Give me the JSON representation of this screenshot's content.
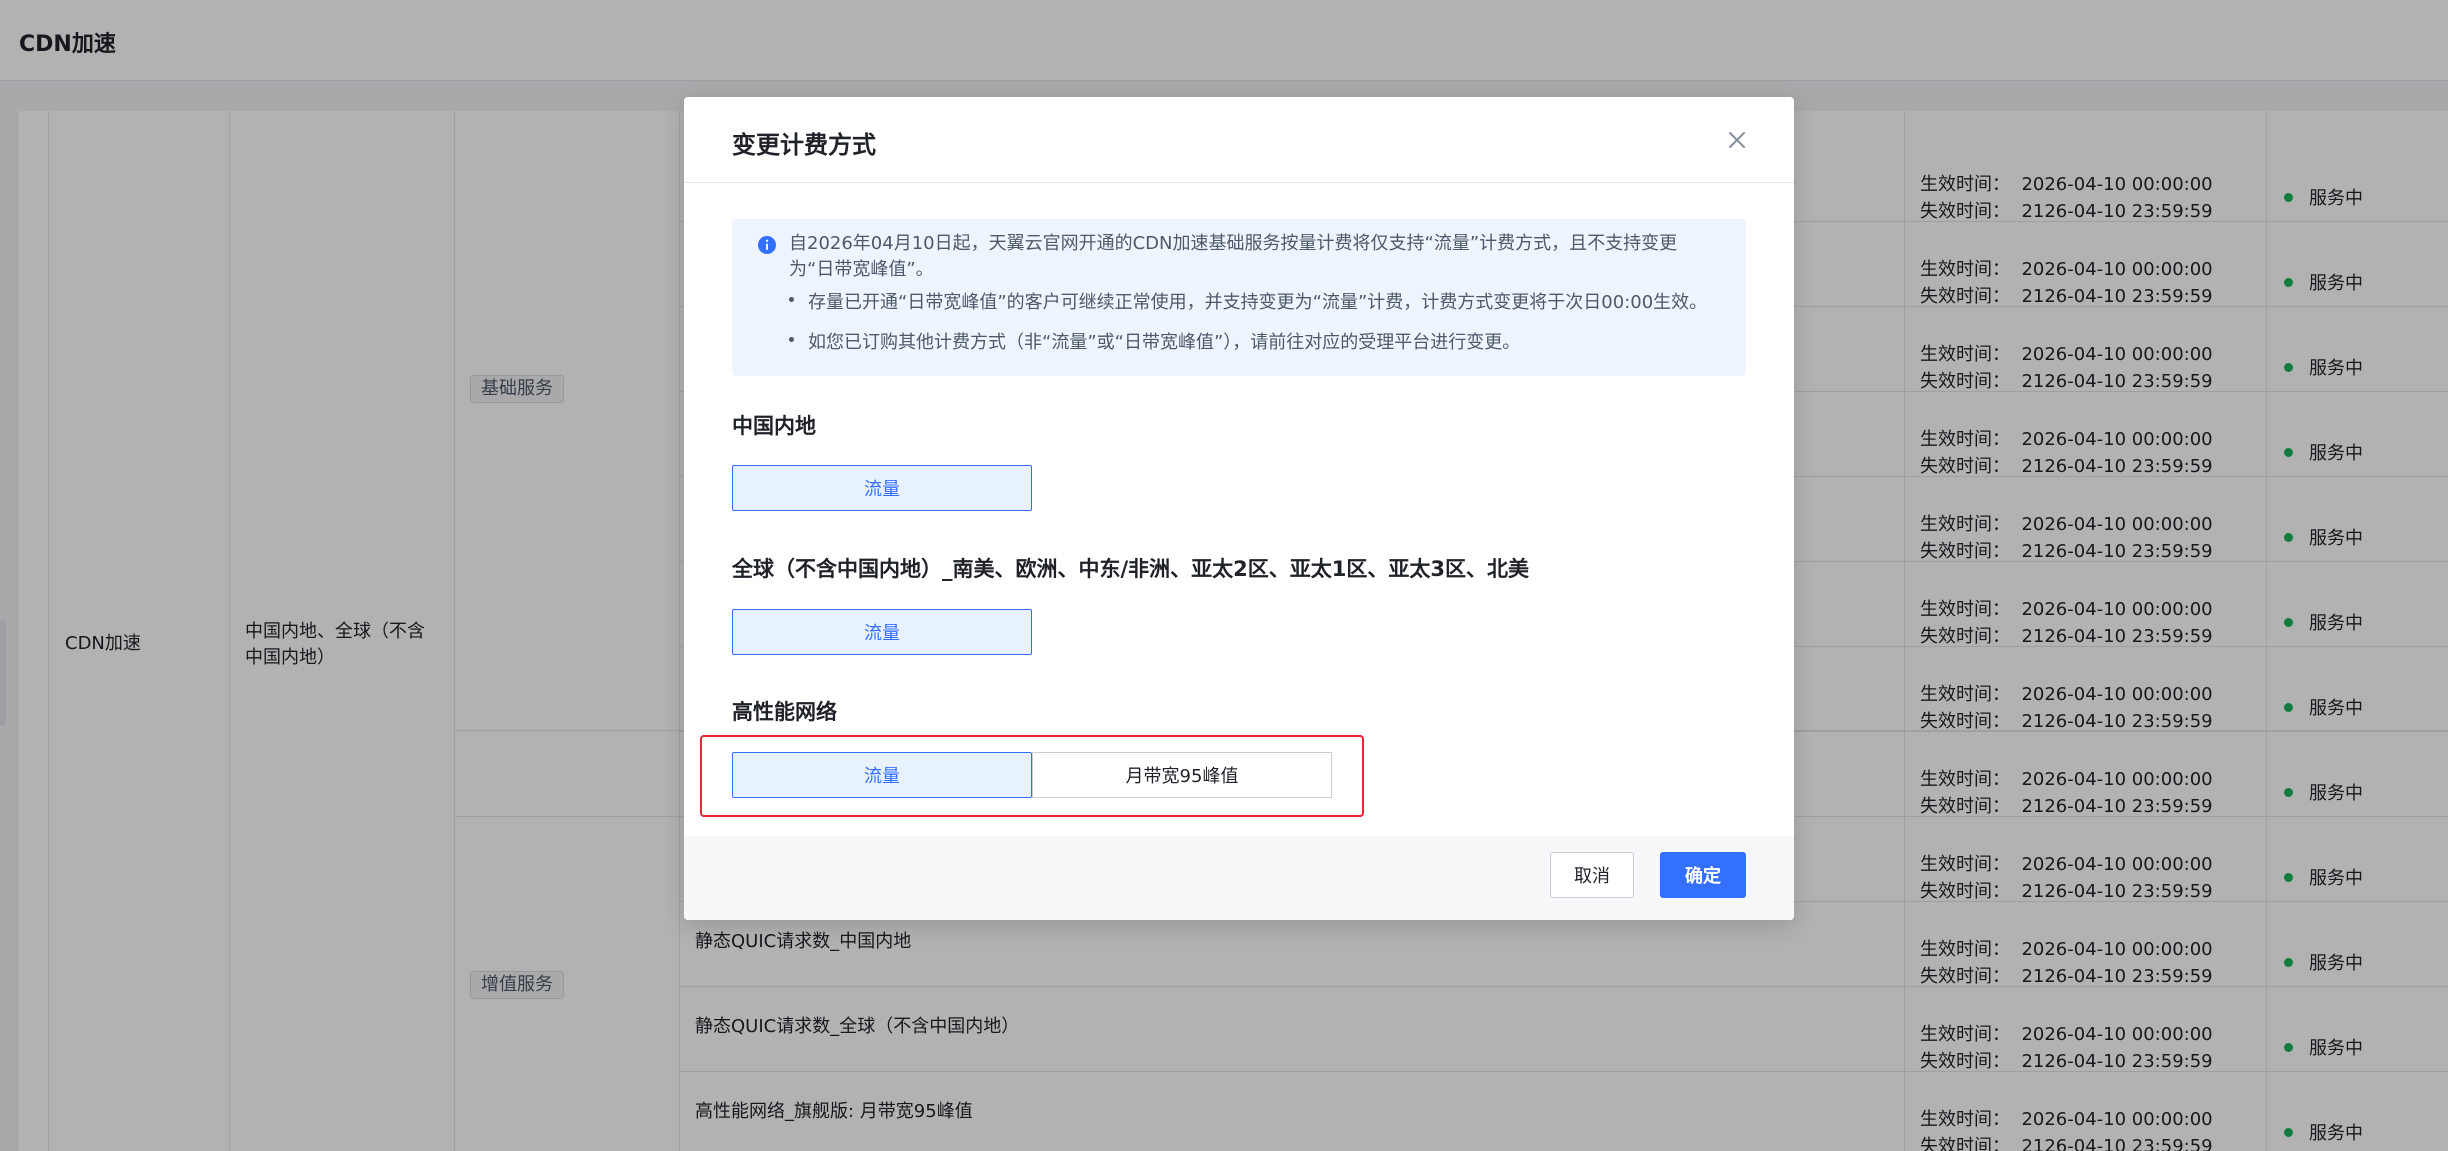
{
  "header": {
    "title": "CDN加速"
  },
  "table": {
    "product": "CDN加速",
    "region": "中国内地、全球（不含中国内地）",
    "groups": [
      "基础服务",
      "增值服务"
    ],
    "service_items": [
      "静态QUIC请求数_中国内地",
      "静态QUIC请求数_全球（不含中国内地）",
      "高性能网络_旗舰版: 月带宽95峰值"
    ],
    "effective_label": "生效时间：",
    "expire_label": "失效时间：",
    "effective_time": "2026-04-10 00:00:00",
    "expire_time": "2126-04-10 23:59:59",
    "status_text": "服务中"
  },
  "modal": {
    "title": "变更计费方式",
    "notice": {
      "main": "自2026年04月10日起，天翼云官网开通的CDN加速基础服务按量计费将仅支持“流量”计费方式，且不支持变更为“日带宽峰值”。",
      "bullets": [
        "存量已开通“日带宽峰值”的客户可继续正常使用，并支持变更为“流量”计费，计费方式变更将于次日00:00生效。",
        "如您已订购其他计费方式（非“流量”或“日带宽峰值”），请前往对应的受理平台进行变更。"
      ]
    },
    "sections": [
      {
        "title": "中国内地",
        "options": [
          "流量"
        ]
      },
      {
        "title": "全球（不含中国内地）_南美、欧洲、中东/非洲、亚太2区、亚太1区、亚太3区、北美",
        "options": [
          "流量"
        ]
      },
      {
        "title": "高性能网络",
        "options": [
          "流量",
          "月带宽95峰值"
        ]
      }
    ],
    "cancel_label": "取消",
    "ok_label": "确定"
  },
  "colors": {
    "primary": "#3370ff",
    "highlight": "#e8283a",
    "status": "#19b35a"
  }
}
